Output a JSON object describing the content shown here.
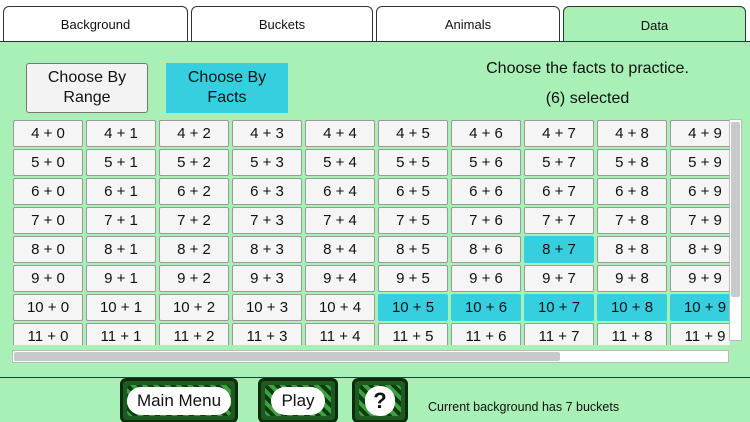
{
  "tabs": [
    "Background",
    "Buckets",
    "Animals",
    "Data"
  ],
  "active_tab": "Data",
  "mode": {
    "range_label_line1": "Choose By",
    "range_label_line2": "Range",
    "facts_label_line1": "Choose By",
    "facts_label_line2": "Facts"
  },
  "instructions": {
    "line1": "Choose the facts to practice.",
    "line2": "(6) selected"
  },
  "facts": [
    [
      "4 + 0",
      "4 + 1",
      "4 + 2",
      "4 + 3",
      "4 + 4",
      "4 + 5",
      "4 + 6",
      "4 + 7",
      "4 + 8",
      "4 + 9"
    ],
    [
      "5 + 0",
      "5 + 1",
      "5 + 2",
      "5 + 3",
      "5 + 4",
      "5 + 5",
      "5 + 6",
      "5 + 7",
      "5 + 8",
      "5 + 9"
    ],
    [
      "6 + 0",
      "6 + 1",
      "6 + 2",
      "6 + 3",
      "6 + 4",
      "6 + 5",
      "6 + 6",
      "6 + 7",
      "6 + 8",
      "6 + 9"
    ],
    [
      "7 + 0",
      "7 + 1",
      "7 + 2",
      "7 + 3",
      "7 + 4",
      "7 + 5",
      "7 + 6",
      "7 + 7",
      "7 + 8",
      "7 + 9"
    ],
    [
      "8 + 0",
      "8 + 1",
      "8 + 2",
      "8 + 3",
      "8 + 4",
      "8 + 5",
      "8 + 6",
      "8 + 7",
      "8 + 8",
      "8 + 9"
    ],
    [
      "9 + 0",
      "9 + 1",
      "9 + 2",
      "9 + 3",
      "9 + 4",
      "9 + 5",
      "9 + 6",
      "9 + 7",
      "9 + 8",
      "9 + 9"
    ],
    [
      "10 + 0",
      "10 + 1",
      "10 + 2",
      "10 + 3",
      "10 + 4",
      "10 + 5",
      "10 + 6",
      "10 + 7",
      "10 + 8",
      "10 + 9"
    ],
    [
      "11 + 0",
      "11 + 1",
      "11 + 2",
      "11 + 3",
      "11 + 4",
      "11 + 5",
      "11 + 6",
      "11 + 7",
      "11 + 8",
      "11 + 9"
    ]
  ],
  "selected_facts": [
    "8 + 7",
    "10 + 5",
    "10 + 6",
    "10 + 7",
    "10 + 8",
    "10 + 9"
  ],
  "bottom": {
    "main_menu": "Main Menu",
    "play": "Play",
    "help": "?",
    "status": "Current background has 7 buckets"
  },
  "colors": {
    "background": "#a9f0b6",
    "selected": "#36cfe0"
  }
}
